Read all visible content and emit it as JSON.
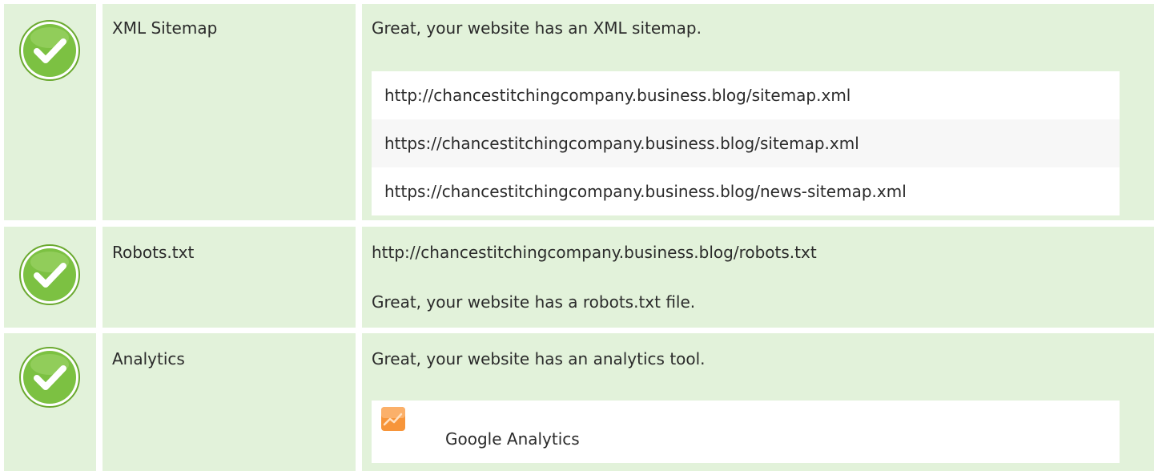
{
  "colors": {
    "row_bg": "#e2f2da",
    "check_green": "#7cc142",
    "list_alt_bg": "#f7f7f7",
    "analytics_orange": "#f7953a"
  },
  "rows": [
    {
      "icon": "check-circle-icon",
      "name": "XML Sitemap",
      "message": "Great, your website has an XML sitemap.",
      "urls": [
        "http://chancestitchingcompany.business.blog/sitemap.xml",
        "https://chancestitchingcompany.business.blog/sitemap.xml",
        "https://chancestitchingcompany.business.blog/news-sitemap.xml"
      ]
    },
    {
      "icon": "check-circle-icon",
      "name": "Robots.txt",
      "url": "http://chancestitchingcompany.business.blog/robots.txt",
      "message": "Great, your website has a robots.txt file."
    },
    {
      "icon": "check-circle-icon",
      "name": "Analytics",
      "message": "Great, your website has an analytics tool.",
      "tools": [
        {
          "icon": "google-analytics-icon",
          "label": "Google Analytics"
        }
      ]
    }
  ]
}
